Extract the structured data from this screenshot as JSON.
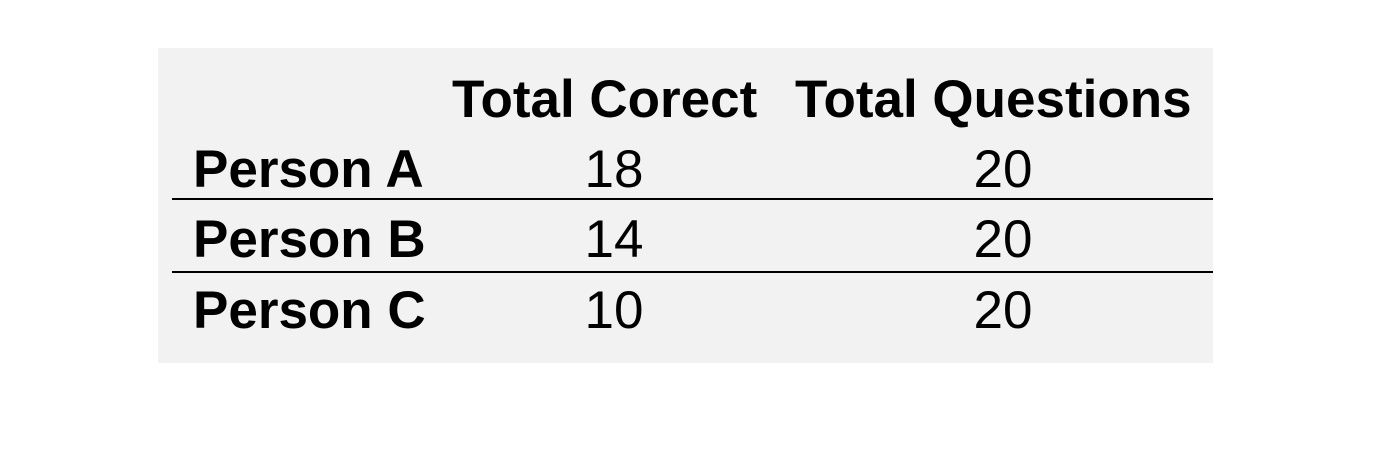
{
  "table": {
    "headers": [
      "",
      "Total Corect",
      "Total Questions"
    ],
    "rows": [
      {
        "label": "Person A",
        "total_correct": "18",
        "total_questions": "20"
      },
      {
        "label": "Person B",
        "total_correct": "14",
        "total_questions": "20"
      },
      {
        "label": "Person C",
        "total_correct": "10",
        "total_questions": "20"
      }
    ]
  }
}
